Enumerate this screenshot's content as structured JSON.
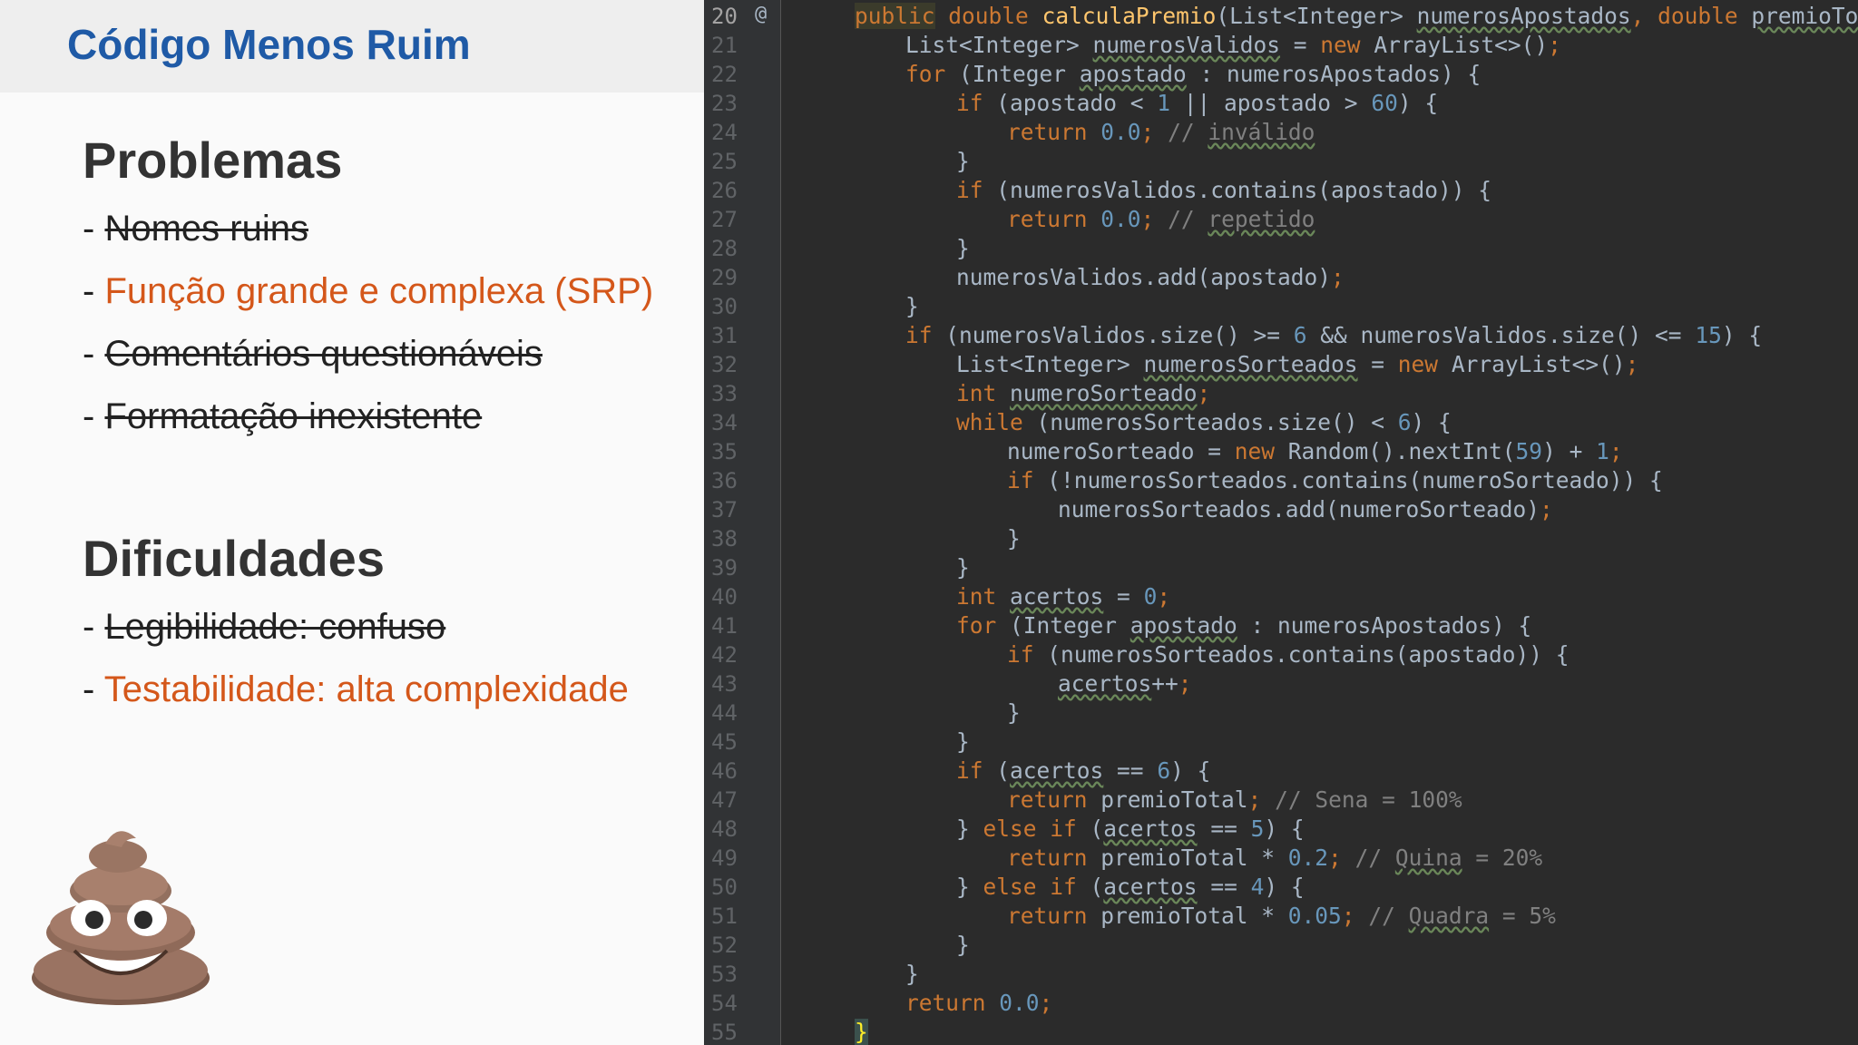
{
  "slide": {
    "title": "Código Menos Ruim",
    "problems": {
      "heading": "Problemas",
      "dash": "-",
      "items": [
        {
          "text": "Nomes ruins"
        },
        {
          "text": "Função grande e complexa (SRP)"
        },
        {
          "text": "Comentários questionáveis"
        },
        {
          "text": "Formatação inexistente"
        }
      ]
    },
    "difficulties": {
      "heading": "Dificuldades",
      "dash": "-",
      "items": [
        {
          "text": "Legibilidade: confuso"
        },
        {
          "text": "Testabilidade: alta complexidade"
        }
      ]
    }
  },
  "editor": {
    "gutter_marker": "@",
    "line_numbers": [
      "20",
      "21",
      "22",
      "23",
      "24",
      "25",
      "26",
      "27",
      "28",
      "29",
      "30",
      "31",
      "32",
      "33",
      "34",
      "35",
      "36",
      "37",
      "38",
      "39",
      "40",
      "41",
      "42",
      "43",
      "44",
      "45",
      "46",
      "47",
      "48",
      "49",
      "50",
      "51",
      "52",
      "53",
      "54",
      "55"
    ],
    "colors": {
      "background": "#2b2b2b",
      "keyword": "#cc7832",
      "number": "#6897bb",
      "comment": "#808080",
      "method_declaration": "#ffc66d",
      "text": "#a9b7c6"
    }
  }
}
